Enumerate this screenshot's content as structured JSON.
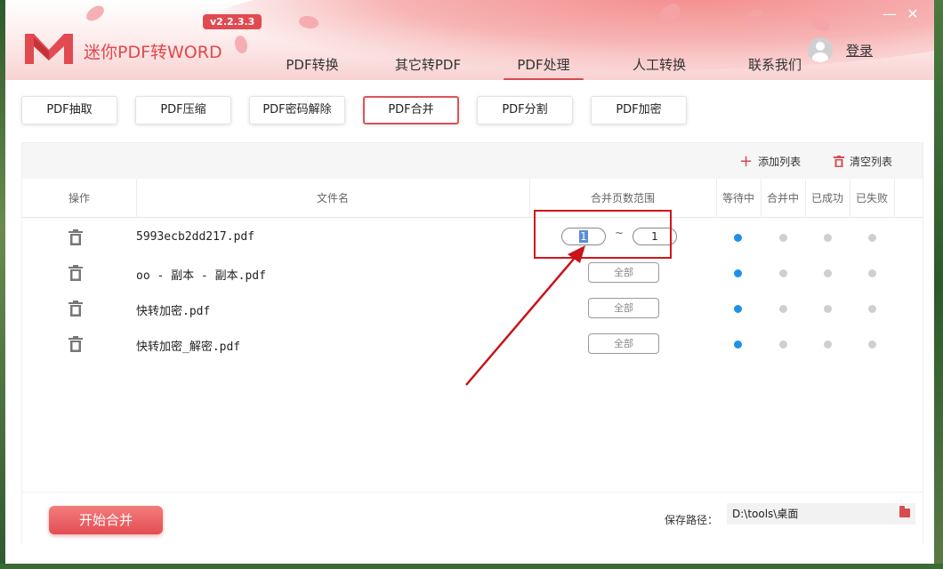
{
  "app": {
    "name": "迷你PDF转WORD",
    "version": "v2.2.3.3",
    "login_label": "登录"
  },
  "nav": {
    "items": [
      {
        "label": "PDF转换",
        "active": false
      },
      {
        "label": "其它转PDF",
        "active": false
      },
      {
        "label": "PDF处理",
        "active": true
      },
      {
        "label": "人工转换",
        "active": false
      },
      {
        "label": "联系我们",
        "active": false
      }
    ]
  },
  "subtabs": {
    "items": [
      {
        "label": "PDF抽取",
        "active": false
      },
      {
        "label": "PDF压缩",
        "active": false
      },
      {
        "label": "PDF密码解除",
        "active": false
      },
      {
        "label": "PDF合并",
        "active": true
      },
      {
        "label": "PDF分割",
        "active": false
      },
      {
        "label": "PDF加密",
        "active": false
      }
    ]
  },
  "toolbar": {
    "add_list": "添加列表",
    "clear_list": "清空列表"
  },
  "table": {
    "headers": {
      "op": "操作",
      "filename": "文件名",
      "range": "合并页数范围",
      "waiting": "等待中",
      "merging": "合并中",
      "success": "已成功",
      "failed": "已失败"
    },
    "rows": [
      {
        "filename": "5993ecb2dd217.pdf",
        "range_from": "1",
        "range_sep": "~",
        "range_to": "1",
        "status": "waiting"
      },
      {
        "filename": "oo - 副本 - 副本.pdf",
        "range": "全部",
        "status": "waiting"
      },
      {
        "filename": "快转加密.pdf",
        "range": "全部",
        "status": "waiting"
      },
      {
        "filename": "快转加密_解密.pdf",
        "range": "全部",
        "status": "waiting"
      }
    ]
  },
  "footer": {
    "start_button": "开始合并",
    "save_label": "保存路径：",
    "save_path": "D:\\tools\\桌面"
  },
  "colors": {
    "accent": "#d84b50",
    "status_active": "#1e90e8",
    "status_inactive": "#cfcfcf",
    "highlight": "#d0161b"
  }
}
